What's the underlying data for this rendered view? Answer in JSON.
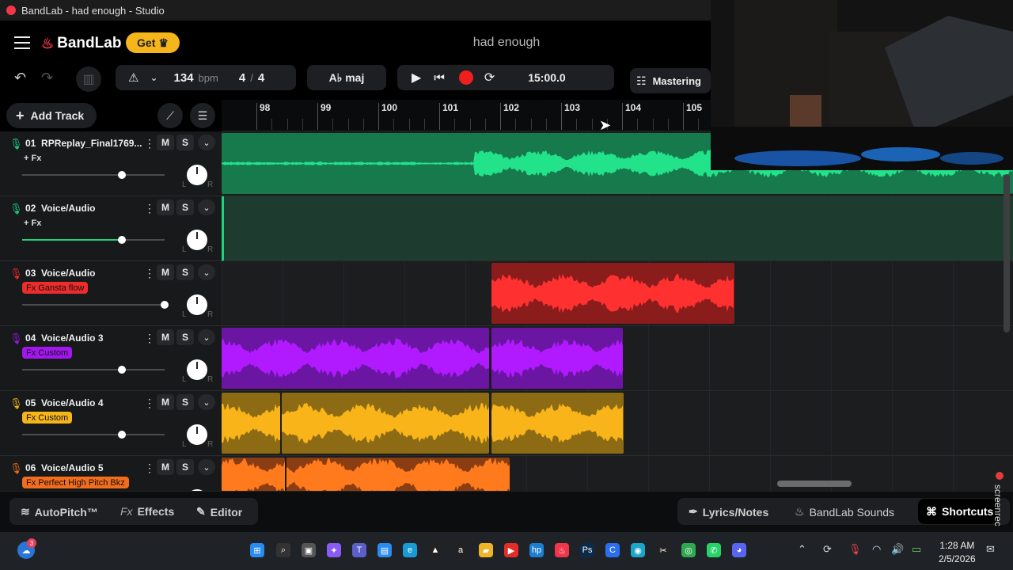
{
  "window": {
    "title": "BandLab - had enough - Studio"
  },
  "header": {
    "brand": "BandLab",
    "get_label": "Get",
    "project_title": "had enough"
  },
  "toolbar": {
    "tempo": "134",
    "tempo_unit": "bpm",
    "time_sig_num": "4",
    "time_sig_sep": "/",
    "time_sig_den": "4",
    "key": "A♭ maj",
    "time": "15:00.0",
    "mastering_label": "Mastering"
  },
  "timeline": {
    "add_track_label": "Add Track",
    "bars": [
      "98",
      "99",
      "100",
      "101",
      "102",
      "103",
      "104",
      "105"
    ]
  },
  "tracks": [
    {
      "number": "01",
      "name": "RPReplay_Final1769...",
      "fx": "+ Fx",
      "color": "#1fd27c",
      "volume": 0.7
    },
    {
      "number": "02",
      "name": "Voice/Audio",
      "fx": "+ Fx",
      "color": "#1fd27c",
      "volume": 0.7
    },
    {
      "number": "03",
      "name": "Voice/Audio",
      "fx": "Fx Gansta flow",
      "color": "#ef2c2c",
      "volume": 1.0
    },
    {
      "number": "04",
      "name": "Voice/Audio 3",
      "fx": "Fx Custom",
      "color": "#a316f0",
      "volume": 0.7
    },
    {
      "number": "05",
      "name": "Voice/Audio 4",
      "fx": "Fx Custom",
      "color": "#f6b51b",
      "volume": 0.7
    },
    {
      "number": "06",
      "name": "Voice/Audio 5",
      "fx": "Fx Perfect High Pitch Bkz",
      "color": "#f36d1c",
      "volume": 0.7
    }
  ],
  "track_buttons": {
    "mute": "M",
    "solo": "S",
    "left": "L",
    "right": "R"
  },
  "bottom": {
    "autopitch": "AutoPitch™",
    "effects": "Effects",
    "effects_prefix": "Fx",
    "editor": "Editor",
    "lyrics": "Lyrics/Notes",
    "sounds": "BandLab Sounds",
    "shortcuts": "Shortcuts",
    "screenrec": "screenrec"
  },
  "taskbar": {
    "time": "1:28 AM",
    "date": "2/5/2026",
    "weather_badge": "3"
  }
}
